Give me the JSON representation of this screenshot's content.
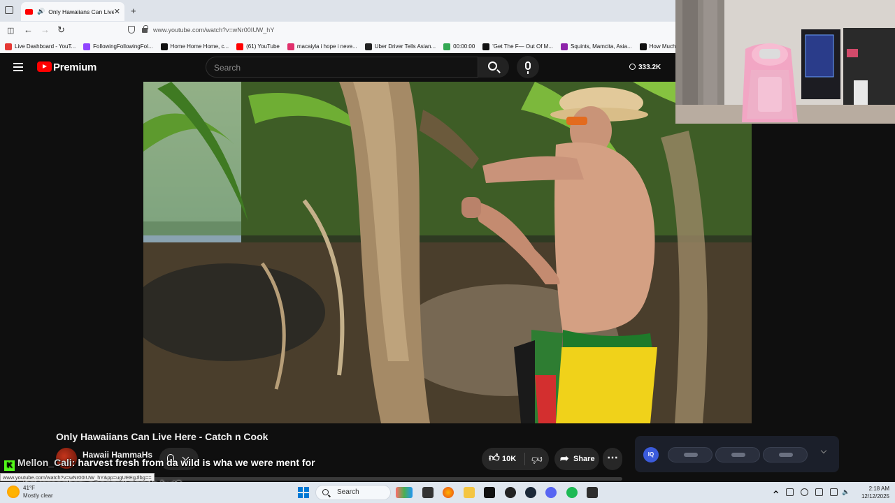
{
  "browser": {
    "tab_title": "Only Hawaiians Can Live He",
    "new_tab": "+",
    "url": "www.youtube.com/watch?v=wNr00IUW_hY",
    "bookmarks": [
      {
        "label": "Live Dashboard - YouT...",
        "color": "#e53935"
      },
      {
        "label": "FollowingFollowingFol...",
        "color": "#9146ff"
      },
      {
        "label": "Home Home Home, c...",
        "color": "#111111"
      },
      {
        "label": "(61) YouTube",
        "color": "#ff0000"
      },
      {
        "label": "macaiyla i hope i neve...",
        "color": "#e1306c"
      },
      {
        "label": "Uber Driver Tells Asian...",
        "color": "#222222"
      },
      {
        "label": "00:00:00",
        "color": "#34a853"
      },
      {
        "label": "'Get The F— Out Of M...",
        "color": "#111111"
      },
      {
        "label": "Squints, Mamcita, Asia...",
        "color": "#8e24aa"
      },
      {
        "label": "How Much Mone",
        "color": "#111111"
      }
    ]
  },
  "youtube": {
    "brand": "Premium",
    "search_placeholder": "Search",
    "view_count": "333.2K",
    "video_title": "Only Hawaiians Can Live Here - Catch n Cook",
    "channel_name": "Hawaii HammaHs",
    "like_count": "10K",
    "share_label": "Share",
    "more_label": "⋯",
    "iq_label": "IQ"
  },
  "chat": [
    {
      "user": "Mellon_Cali:",
      "message": "harvest fresh from da wild is wha we were ment for"
    },
    {
      "user": "TheScreecher:",
      "message": "coconut panda hut?"
    }
  ],
  "status_url": "www.youtube.com/watch?v=wNr00IUW_hY&pp=ugUEEgJlbg==",
  "taskbar": {
    "temp": "41°F",
    "weather": "Mostly clear",
    "search": "Search",
    "time": "2:18 AM",
    "date": "12/12/2025"
  }
}
